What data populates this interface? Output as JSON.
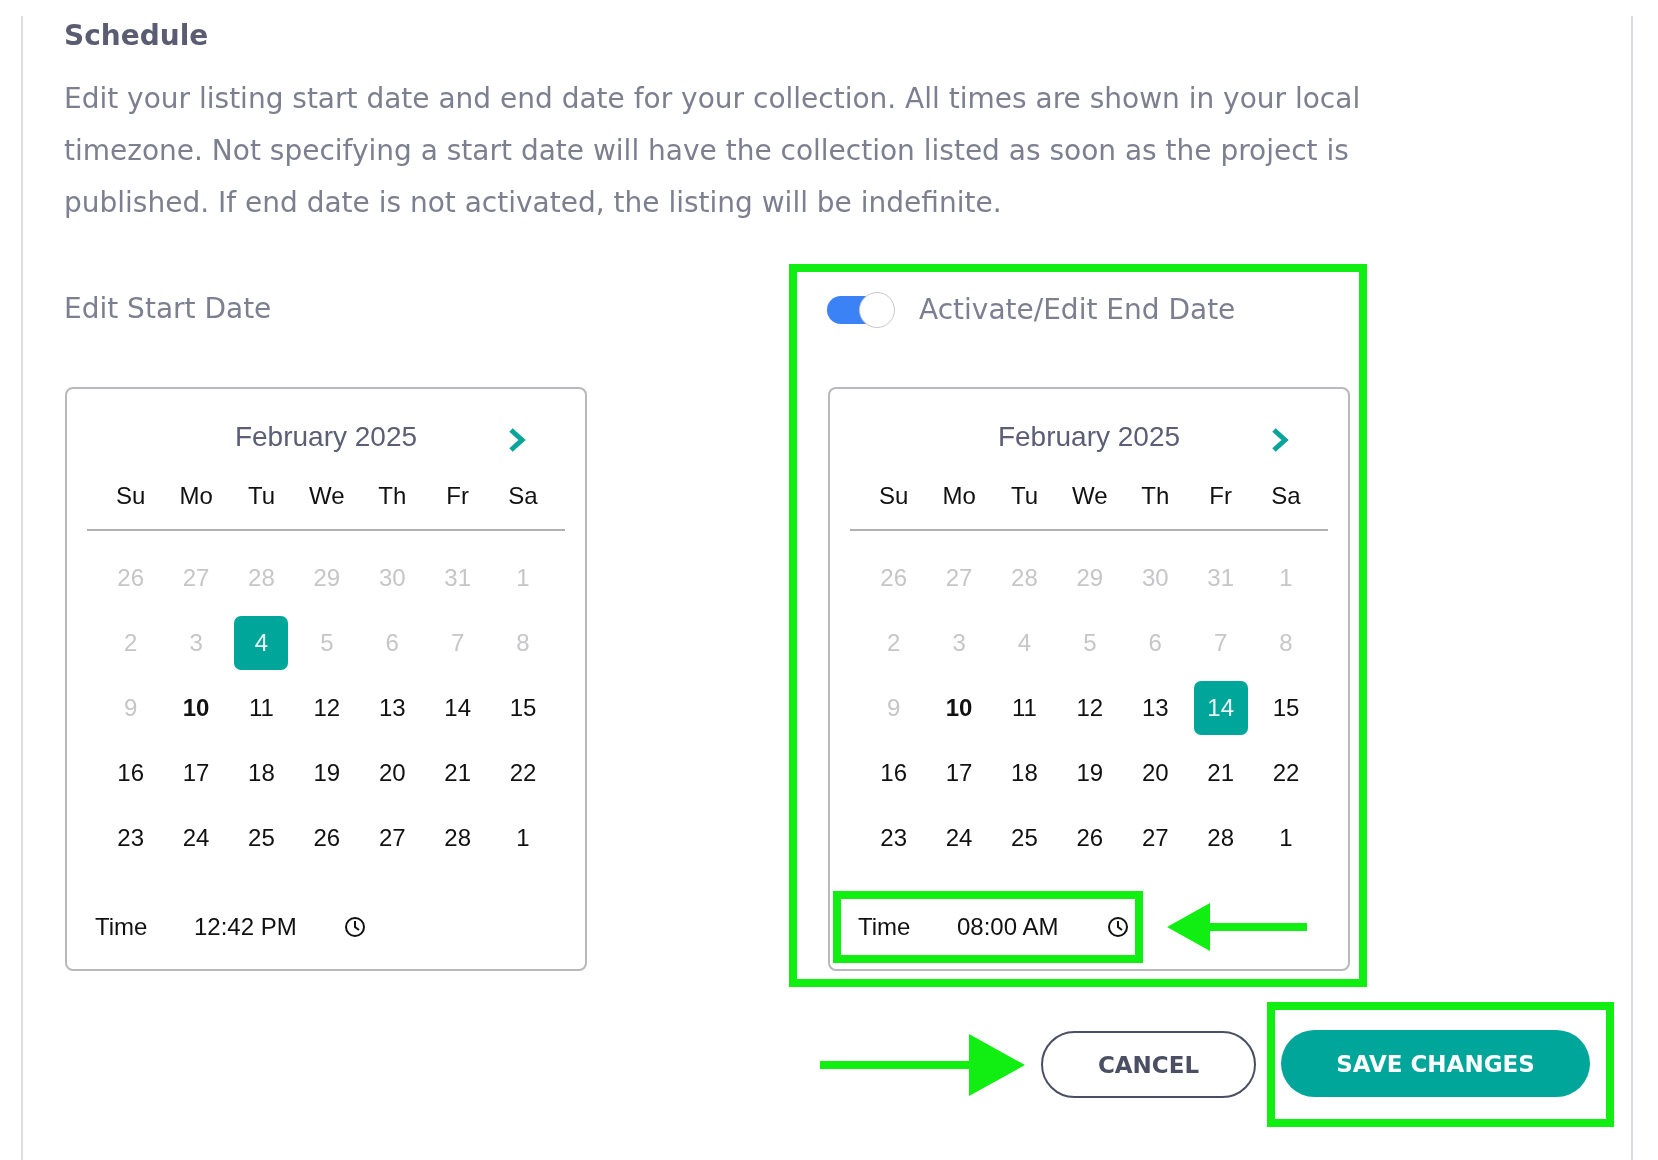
{
  "section_title": "Schedule",
  "description": "Edit your listing start date and end date for your collection. All times are shown in your local timezone. Not specifying a start date will have the collection listed as soon as the project is published. If end date is not activated, the listing will be indefinite.",
  "start_date": {
    "label": "Edit Start Date",
    "calendar": {
      "month": "February 2025",
      "weekdays": [
        "Su",
        "Mo",
        "Tu",
        "We",
        "Th",
        "Fr",
        "Sa"
      ],
      "days": [
        {
          "label": "26",
          "muted": true,
          "today": false,
          "selected": false
        },
        {
          "label": "27",
          "muted": true,
          "today": false,
          "selected": false
        },
        {
          "label": "28",
          "muted": true,
          "today": false,
          "selected": false
        },
        {
          "label": "29",
          "muted": true,
          "today": false,
          "selected": false
        },
        {
          "label": "30",
          "muted": true,
          "today": false,
          "selected": false
        },
        {
          "label": "31",
          "muted": true,
          "today": false,
          "selected": false
        },
        {
          "label": "1",
          "muted": true,
          "today": false,
          "selected": false
        },
        {
          "label": "2",
          "muted": true,
          "today": false,
          "selected": false
        },
        {
          "label": "3",
          "muted": true,
          "today": false,
          "selected": false
        },
        {
          "label": "4",
          "muted": true,
          "today": false,
          "selected": true
        },
        {
          "label": "5",
          "muted": true,
          "today": false,
          "selected": false
        },
        {
          "label": "6",
          "muted": true,
          "today": false,
          "selected": false
        },
        {
          "label": "7",
          "muted": true,
          "today": false,
          "selected": false
        },
        {
          "label": "8",
          "muted": true,
          "today": false,
          "selected": false
        },
        {
          "label": "9",
          "muted": true,
          "today": false,
          "selected": false
        },
        {
          "label": "10",
          "muted": false,
          "today": true,
          "selected": false
        },
        {
          "label": "11",
          "muted": false,
          "today": false,
          "selected": false
        },
        {
          "label": "12",
          "muted": false,
          "today": false,
          "selected": false
        },
        {
          "label": "13",
          "muted": false,
          "today": false,
          "selected": false
        },
        {
          "label": "14",
          "muted": false,
          "today": false,
          "selected": false
        },
        {
          "label": "15",
          "muted": false,
          "today": false,
          "selected": false
        },
        {
          "label": "16",
          "muted": false,
          "today": false,
          "selected": false
        },
        {
          "label": "17",
          "muted": false,
          "today": false,
          "selected": false
        },
        {
          "label": "18",
          "muted": false,
          "today": false,
          "selected": false
        },
        {
          "label": "19",
          "muted": false,
          "today": false,
          "selected": false
        },
        {
          "label": "20",
          "muted": false,
          "today": false,
          "selected": false
        },
        {
          "label": "21",
          "muted": false,
          "today": false,
          "selected": false
        },
        {
          "label": "22",
          "muted": false,
          "today": false,
          "selected": false
        },
        {
          "label": "23",
          "muted": false,
          "today": false,
          "selected": false
        },
        {
          "label": "24",
          "muted": false,
          "today": false,
          "selected": false
        },
        {
          "label": "25",
          "muted": false,
          "today": false,
          "selected": false
        },
        {
          "label": "26",
          "muted": false,
          "today": false,
          "selected": false
        },
        {
          "label": "27",
          "muted": false,
          "today": false,
          "selected": false
        },
        {
          "label": "28",
          "muted": false,
          "today": false,
          "selected": false
        },
        {
          "label": "1",
          "muted": false,
          "today": false,
          "selected": false
        }
      ],
      "time": {
        "label": "Time",
        "value": "12:42 PM",
        "highlighted": false,
        "arrow": false
      }
    }
  },
  "end_date": {
    "label": "Activate/Edit End Date",
    "enabled": true,
    "highlighted": true,
    "calendar": {
      "month": "February 2025",
      "weekdays": [
        "Su",
        "Mo",
        "Tu",
        "We",
        "Th",
        "Fr",
        "Sa"
      ],
      "days": [
        {
          "label": "26",
          "muted": true,
          "today": false,
          "selected": false
        },
        {
          "label": "27",
          "muted": true,
          "today": false,
          "selected": false
        },
        {
          "label": "28",
          "muted": true,
          "today": false,
          "selected": false
        },
        {
          "label": "29",
          "muted": true,
          "today": false,
          "selected": false
        },
        {
          "label": "30",
          "muted": true,
          "today": false,
          "selected": false
        },
        {
          "label": "31",
          "muted": true,
          "today": false,
          "selected": false
        },
        {
          "label": "1",
          "muted": true,
          "today": false,
          "selected": false
        },
        {
          "label": "2",
          "muted": true,
          "today": false,
          "selected": false
        },
        {
          "label": "3",
          "muted": true,
          "today": false,
          "selected": false
        },
        {
          "label": "4",
          "muted": true,
          "today": false,
          "selected": false
        },
        {
          "label": "5",
          "muted": true,
          "today": false,
          "selected": false
        },
        {
          "label": "6",
          "muted": true,
          "today": false,
          "selected": false
        },
        {
          "label": "7",
          "muted": true,
          "today": false,
          "selected": false
        },
        {
          "label": "8",
          "muted": true,
          "today": false,
          "selected": false
        },
        {
          "label": "9",
          "muted": true,
          "today": false,
          "selected": false
        },
        {
          "label": "10",
          "muted": false,
          "today": true,
          "selected": false
        },
        {
          "label": "11",
          "muted": false,
          "today": false,
          "selected": false
        },
        {
          "label": "12",
          "muted": false,
          "today": false,
          "selected": false
        },
        {
          "label": "13",
          "muted": false,
          "today": false,
          "selected": false
        },
        {
          "label": "14",
          "muted": false,
          "today": false,
          "selected": true
        },
        {
          "label": "15",
          "muted": false,
          "today": false,
          "selected": false
        },
        {
          "label": "16",
          "muted": false,
          "today": false,
          "selected": false
        },
        {
          "label": "17",
          "muted": false,
          "today": false,
          "selected": false
        },
        {
          "label": "18",
          "muted": false,
          "today": false,
          "selected": false
        },
        {
          "label": "19",
          "muted": false,
          "today": false,
          "selected": false
        },
        {
          "label": "20",
          "muted": false,
          "today": false,
          "selected": false
        },
        {
          "label": "21",
          "muted": false,
          "today": false,
          "selected": false
        },
        {
          "label": "22",
          "muted": false,
          "today": false,
          "selected": false
        },
        {
          "label": "23",
          "muted": false,
          "today": false,
          "selected": false
        },
        {
          "label": "24",
          "muted": false,
          "today": false,
          "selected": false
        },
        {
          "label": "25",
          "muted": false,
          "today": false,
          "selected": false
        },
        {
          "label": "26",
          "muted": false,
          "today": false,
          "selected": false
        },
        {
          "label": "27",
          "muted": false,
          "today": false,
          "selected": false
        },
        {
          "label": "28",
          "muted": false,
          "today": false,
          "selected": false
        },
        {
          "label": "1",
          "muted": false,
          "today": false,
          "selected": false
        }
      ],
      "time": {
        "label": "Time",
        "value": "08:00 AM",
        "highlighted": true,
        "arrow": true
      }
    }
  },
  "buttons": [
    {
      "label": "CANCEL",
      "kind": "secondary",
      "highlighted": false,
      "arrow": true
    },
    {
      "label": "SAVE CHANGES",
      "kind": "primary",
      "highlighted": true,
      "arrow": false
    }
  ]
}
